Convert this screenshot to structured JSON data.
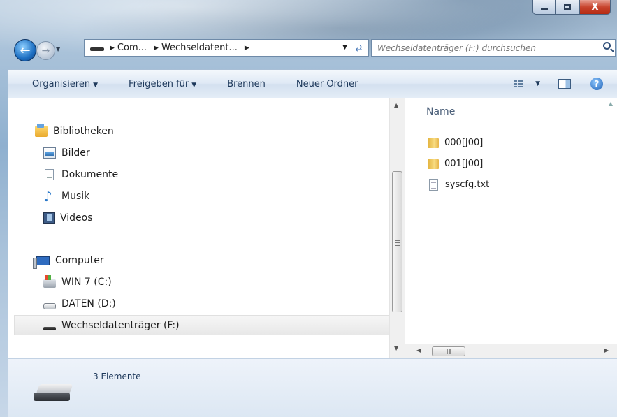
{
  "window": {
    "caption_buttons": {
      "close_glyph": "X"
    }
  },
  "nav": {
    "breadcrumbs": [
      "Com...",
      "Wechseldatent..."
    ],
    "search_placeholder": "Wechseldatenträger (F:) durchsuchen"
  },
  "toolbar": {
    "organize_label": "Organisieren",
    "share_label": "Freigeben für",
    "burn_label": "Brennen",
    "new_folder_label": "Neuer Ordner"
  },
  "navpane": {
    "libraries": {
      "label": "Bibliotheken",
      "items": [
        "Bilder",
        "Dokumente",
        "Musik",
        "Videos"
      ]
    },
    "computer": {
      "label": "Computer",
      "items": [
        "WIN 7 (C:)",
        "DATEN (D:)",
        "Wechseldatenträger (F:)"
      ]
    }
  },
  "filepane": {
    "column_header": "Name",
    "files": [
      {
        "name": "000[J00]",
        "type": "folder"
      },
      {
        "name": "001[J00]",
        "type": "folder"
      },
      {
        "name": "syscfg.txt",
        "type": "text-file"
      }
    ]
  },
  "details": {
    "status_text": "3 Elemente"
  }
}
